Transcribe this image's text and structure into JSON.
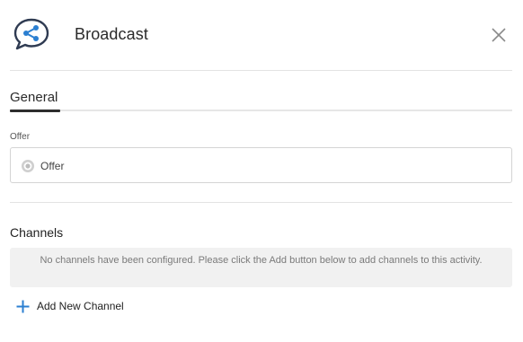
{
  "header": {
    "title": "Broadcast",
    "icon": "broadcast-share-chat-icon",
    "close_icon": "close-icon"
  },
  "tabs": [
    {
      "label": "General",
      "active": true
    }
  ],
  "offer": {
    "label": "Offer",
    "value": "Offer",
    "icon": "target-circle-icon"
  },
  "channels": {
    "heading": "Channels",
    "empty_message": "No channels have been configured. Please click the Add button below to add channels to this activity.",
    "add_label": "Add New Channel",
    "add_icon": "plus-icon"
  },
  "colors": {
    "accent": "#2b7fd1",
    "icon_dark": "#2f3b52",
    "notice_bg": "#f1f1f1"
  }
}
